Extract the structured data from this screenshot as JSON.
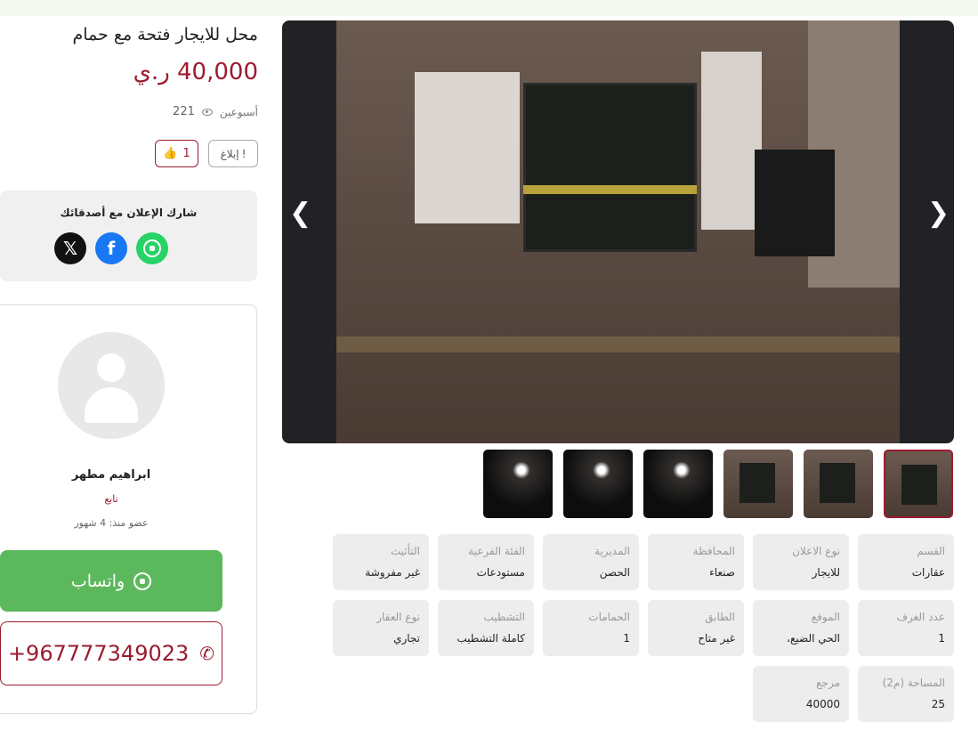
{
  "listing": {
    "title": "محل للايجار فتحة مع حمام",
    "price": "40,000 ر.ي",
    "posted": "أسبوعين",
    "views": "221",
    "likes": "1",
    "report_label": "إبلاغ"
  },
  "share": {
    "title": "شارك الإعلان مع أصدقائك",
    "x_glyph": "𝕏",
    "facebook_glyph": "f"
  },
  "seller": {
    "name": "ابراهيم مطهر",
    "follow_label": "تابع",
    "member_since": "عضو منذ: 4 شهور",
    "whatsapp_label": "واتساب",
    "phone": "+967777349023"
  },
  "gallery": {
    "prev_glyph": "❮",
    "next_glyph": "❯",
    "thumb_count": 6,
    "selected_index": 0
  },
  "specs": [
    {
      "label": "القسم",
      "value": "عقارات"
    },
    {
      "label": "نوع الاعلان",
      "value": "للايجار"
    },
    {
      "label": "المحافظة",
      "value": "صنعاء"
    },
    {
      "label": "المديرية",
      "value": "الحصن"
    },
    {
      "label": "الفئة الفرعية",
      "value": "مستودعات"
    },
    {
      "label": "التأثيث",
      "value": "غير مفروشة"
    },
    {
      "label": "عدد الغرف",
      "value": "1"
    },
    {
      "label": "الموقع",
      "value": "الحي الضيع،"
    },
    {
      "label": "الطابق",
      "value": "غير متاح"
    },
    {
      "label": "الحمامات",
      "value": "1"
    },
    {
      "label": "التشطيب",
      "value": "كاملة التشطيب"
    },
    {
      "label": "نوع العقار",
      "value": "تجاري"
    },
    {
      "label": "المساحة (م2)",
      "value": "25"
    },
    {
      "label": "مرجع",
      "value": "40000"
    }
  ],
  "colors": {
    "accent": "#9b1b30",
    "whatsapp": "#5cb85c",
    "facebook": "#1877f2"
  }
}
